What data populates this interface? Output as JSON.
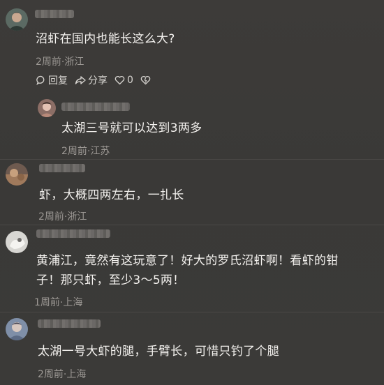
{
  "comments": [
    {
      "text": "沼虾在国内也能长这么大?",
      "meta": "2周前·浙江",
      "actions": {
        "reply": "回复",
        "share": "分享",
        "likes": "0"
      },
      "reply": {
        "text": "太湖三号就可以达到3两多",
        "meta": "2周前·江苏"
      }
    },
    {
      "text": "虾，大概四两左右，一扎长",
      "meta": "2周前·浙江"
    },
    {
      "text_line1": "黄浦江，竟然有这玩意了！好大的罗氏沼虾啊！看虾的钳",
      "text_line2": "子！那只虾，至少3～5两！",
      "meta": "1周前·上海"
    },
    {
      "text": "太湖一号大虾的腿，手臂长，可惜只钓了个腿",
      "meta": "2周前·上海"
    }
  ],
  "colors": {
    "background": "#3c3a38",
    "text": "#f4f2ef",
    "meta": "#9c9894"
  },
  "icons": [
    "comment-icon",
    "share-icon",
    "heart-icon",
    "dislike-heart-icon"
  ]
}
